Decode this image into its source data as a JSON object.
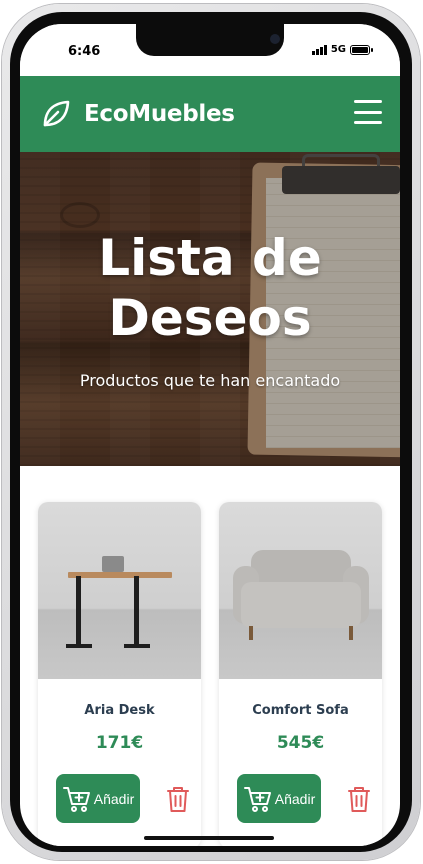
{
  "status": {
    "time": "6:46",
    "network": "5G"
  },
  "header": {
    "brand": "EcoMuebles",
    "logo_icon": "leaf-icon",
    "menu_icon": "hamburger-menu-icon"
  },
  "hero": {
    "title": "Lista de Deseos",
    "subtitle": "Productos que te han encantado"
  },
  "products": [
    {
      "name": "Aria Desk",
      "price": "171€",
      "add_label": "Añadir",
      "image": "standing-desk-photo"
    },
    {
      "name": "Comfort Sofa",
      "price": "545€",
      "add_label": "Añadir",
      "image": "grey-armchair-photo"
    }
  ],
  "colors": {
    "primary": "#2e8b57",
    "price": "#2e8b57",
    "name": "#2c3e50",
    "trash": "#e05a5a"
  }
}
